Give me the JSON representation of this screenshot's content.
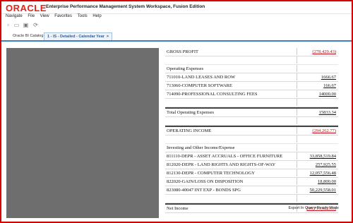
{
  "app": {
    "logo": "ORACLE",
    "title": "Enterprise Performance Management System Workspace, Fusion Edition"
  },
  "menu": [
    "Navigate",
    "File",
    "View",
    "Favorites",
    "Tools",
    "Help"
  ],
  "tabs": [
    {
      "label": "Oracle BI Catalog"
    },
    {
      "label": "1 - IS - Detailed - Calendar Year",
      "close": "×"
    }
  ],
  "report": {
    "rows": [
      {
        "label": "GROSS PROFIT",
        "value": "(278,429.43)"
      },
      {
        "label": "",
        "value": ""
      },
      {
        "label": "Operating Expenses",
        "value": ""
      },
      {
        "label": "711010-LAND LEASES AND ROW",
        "value": "1666.67"
      },
      {
        "label": "713060-COMPUTER SOFTWARE",
        "value": "166.67"
      },
      {
        "label": "714090-PROFESSIONAL CONSULTING FEES",
        "value": "14000.00"
      },
      {
        "label": "",
        "value": ""
      },
      {
        "label": "Total Operating Expenses",
        "value": "15833.34"
      },
      {
        "label": "",
        "value": ""
      },
      {
        "label": "OPERATING INCOME",
        "value": "(294,262.77)"
      },
      {
        "label": "",
        "value": ""
      },
      {
        "label": "Investing and Other Income/Expense",
        "value": ""
      },
      {
        "label": "811110-DEPR - ASSET ACCRUALS - OFFICE FURNITURE",
        "value": "33,858,519.84"
      },
      {
        "label": "812020-DEPR - LAND RIGHTS AND RIGHTS-OF-WAY",
        "value": "257,925.55"
      },
      {
        "label": "812130-DEPR - COMPUTER TECHNOLOGY",
        "value": "12,057,556.48"
      },
      {
        "label": "822020-GAIN/LOSS ON DISPOSITION",
        "value": "18,800.00"
      },
      {
        "label": "823080-40047 INT EXP - BONDS SPG",
        "value": "50,229,558.01"
      },
      {
        "label": "",
        "value": ""
      },
      {
        "label": "Net Income",
        "value": "(96,716,622.65)"
      }
    ]
  },
  "footer": {
    "export": "Export In Query-Ready Mode"
  },
  "colors": {
    "accent": "#e2231a",
    "negative": "#c0111b",
    "tab": "#3a7fbf"
  }
}
